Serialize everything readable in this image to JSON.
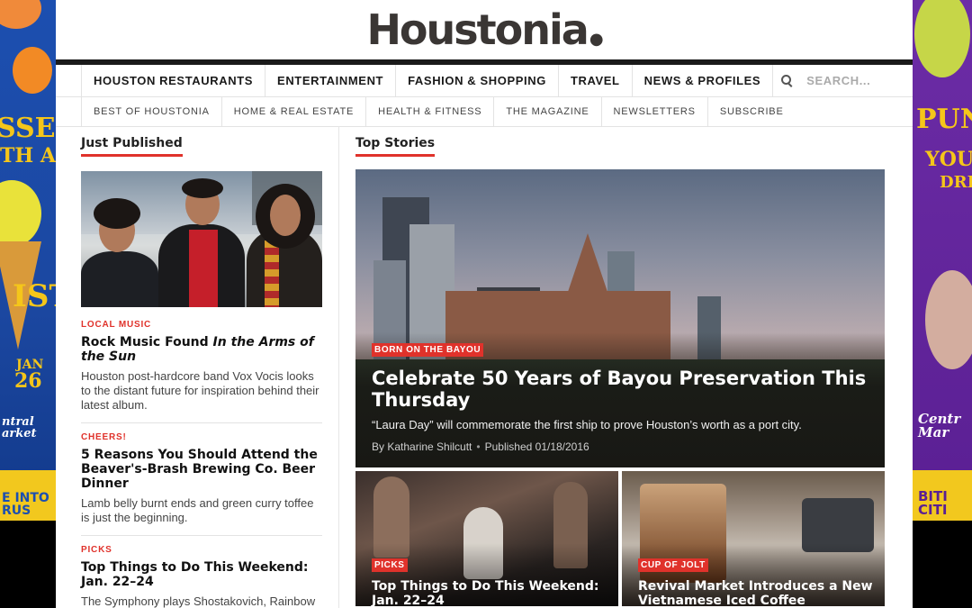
{
  "logo": {
    "text": "Houstonia"
  },
  "nav_primary": [
    "HOUSTON RESTAURANTS",
    "ENTERTAINMENT",
    "FASHION & SHOPPING",
    "TRAVEL",
    "NEWS & PROFILES"
  ],
  "search": {
    "placeholder": "SEARCH..."
  },
  "nav_secondary": [
    "BEST OF HOUSTONIA",
    "HOME & REAL ESTATE",
    "HEALTH & FITNESS",
    "THE MAGAZINE",
    "NEWSLETTERS",
    "SUBSCRIBE"
  ],
  "just_published": {
    "heading": "Just Published",
    "stories": [
      {
        "kicker": "LOCAL MUSIC",
        "title_a": "Rock Music Found ",
        "title_b": "In the Arms of the Sun",
        "dek": "Houston post-hardcore band Vox Vocis looks to the distant future for inspiration behind their latest album."
      },
      {
        "kicker": "CHEERS!",
        "title": "5 Reasons You Should Attend the Beaver's-Brash Brewing Co. Beer Dinner",
        "dek": "Lamb belly burnt ends and green curry toffee is just the beginning."
      },
      {
        "kicker": "PICKS",
        "title": "Top Things to Do This Weekend: Jan. 22–24",
        "dek": "The Symphony plays Shostakovich, Rainbow"
      }
    ]
  },
  "top_stories": {
    "heading": "Top Stories",
    "hero": {
      "tag": "BORN ON THE BAYOU",
      "title": "Celebrate 50 Years of Bayou Preservation This Thursday",
      "dek": "“Laura Day” will commemorate the first ship to prove Houston’s worth as a port city.",
      "author": "By Katharine Shilcutt",
      "published": "Published 01/18/2016"
    },
    "tiles": [
      {
        "tag": "PICKS",
        "title": "Top Things to Do This Weekend: Jan. 22–24"
      },
      {
        "tag": "CUP OF JOLT",
        "title": "Revival Market Introduces a New Vietnamese Iced Coffee"
      }
    ]
  },
  "ads": {
    "left": {
      "line1": "SSERT",
      "line2": "TH A",
      "line3": "IST",
      "date1": "JAN",
      "date2": "26",
      "script": "ntral arket",
      "strip": "E INTO RUS"
    },
    "right": {
      "line1": "PUN",
      "line2": "YOU",
      "line3": "DRI",
      "script": "Centr Mar",
      "strip": "BITI CITI"
    }
  }
}
